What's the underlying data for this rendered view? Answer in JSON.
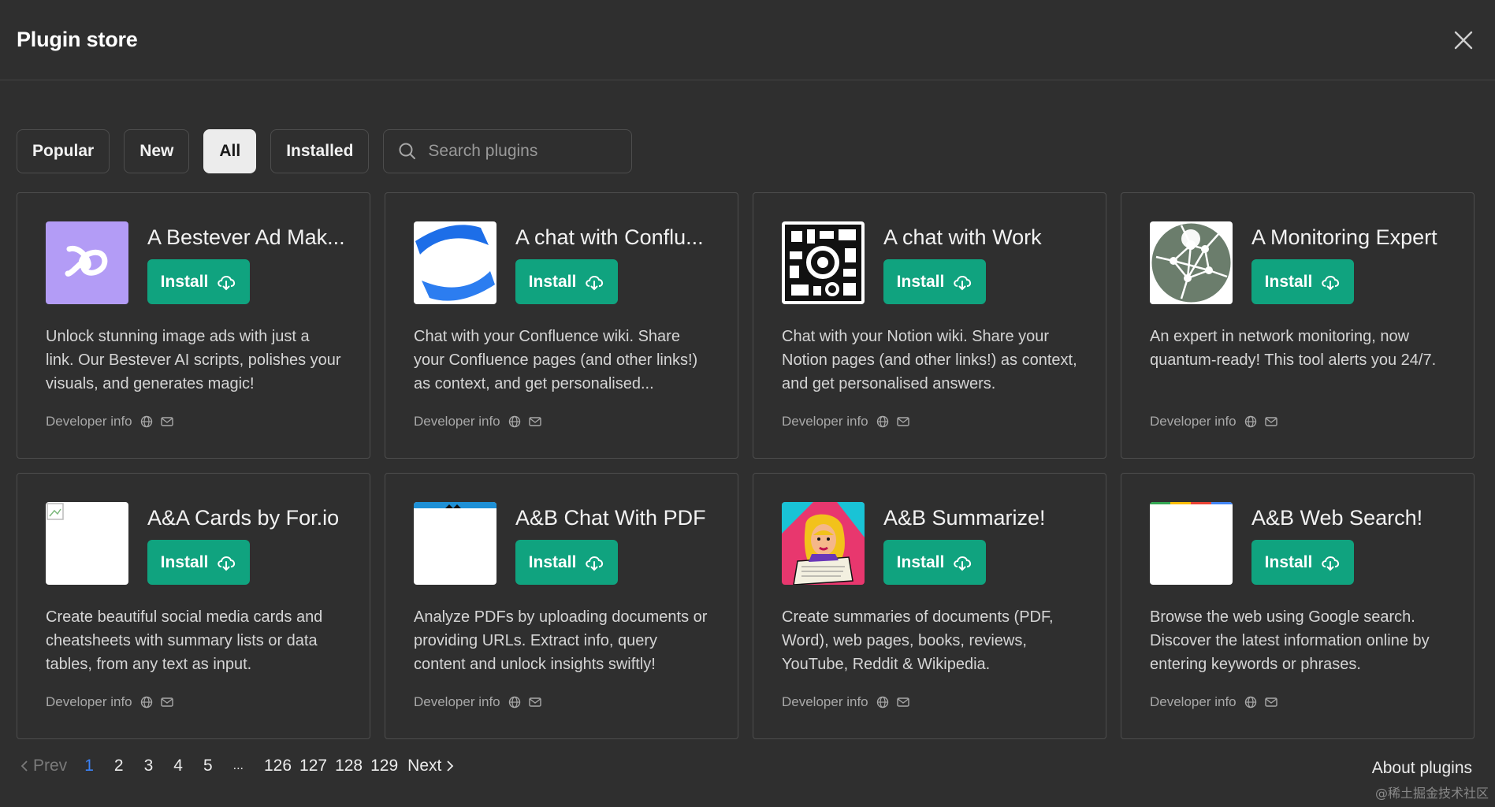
{
  "header": {
    "title": "Plugin store"
  },
  "filters": [
    {
      "label": "Popular",
      "active": false
    },
    {
      "label": "New",
      "active": false
    },
    {
      "label": "All",
      "active": true
    },
    {
      "label": "Installed",
      "active": false
    }
  ],
  "search": {
    "placeholder": "Search plugins",
    "value": ""
  },
  "plugins": [
    {
      "title": "A Bestever Ad Mak...",
      "install_label": "Install",
      "description": "Unlock stunning image ads with just a link. Our Bestever AI scripts, polishes your visuals, and generates magic!",
      "developer_label": "Developer info",
      "icon": "bestever-logo"
    },
    {
      "title": "A chat with Conflu...",
      "install_label": "Install",
      "description": "Chat with your Confluence wiki. Share your Confluence pages (and other links!) as context, and get personalised...",
      "developer_label": "Developer info",
      "icon": "confluence-logo"
    },
    {
      "title": "A chat with Work",
      "install_label": "Install",
      "description": "Chat with your Notion wiki. Share your Notion pages (and other links!) as context, and get personalised answers.",
      "developer_label": "Developer info",
      "icon": "work-logo"
    },
    {
      "title": "A Monitoring Expert",
      "install_label": "Install",
      "description": "An expert in network monitoring, now quantum-ready! This tool alerts you 24/7.",
      "developer_label": "Developer info",
      "icon": "network-globe-logo"
    },
    {
      "title": "A&A Cards by For.io",
      "install_label": "Install",
      "description": "Create beautiful social media cards and cheatsheets with summary lists or data tables, from any text as input.",
      "developer_label": "Developer info",
      "icon": "broken-image-logo"
    },
    {
      "title": "A&B Chat With PDF",
      "install_label": "Install",
      "description": "Analyze PDFs by uploading documents or providing URLs. Extract info, query content and unlock insights swiftly!",
      "developer_label": "Developer info",
      "icon": "pdf-logo"
    },
    {
      "title": "A&B Summarize!",
      "install_label": "Install",
      "description": "Create summaries of documents (PDF, Word), web pages, books, reviews, YouTube, Reddit & Wikipedia.",
      "developer_label": "Developer info",
      "icon": "pop-art-reader-logo"
    },
    {
      "title": "A&B Web Search!",
      "install_label": "Install",
      "description": "Browse the web using Google search. Discover the latest information online by entering keywords or phrases.",
      "developer_label": "Developer info",
      "icon": "web-search-logo"
    }
  ],
  "pagination": {
    "prev_label": "Prev",
    "next_label": "Next",
    "current_page": "1",
    "pages": [
      "1",
      "2",
      "3",
      "4",
      "5",
      "...",
      "126",
      "127",
      "128",
      "129"
    ]
  },
  "footer": {
    "about_label": "About plugins",
    "watermark": "@稀土掘金技术社区"
  },
  "colors": {
    "background": "#2f2f2f",
    "install_green": "#10a37f",
    "active_page": "#3b82f6",
    "border": "#4d4d4d"
  }
}
